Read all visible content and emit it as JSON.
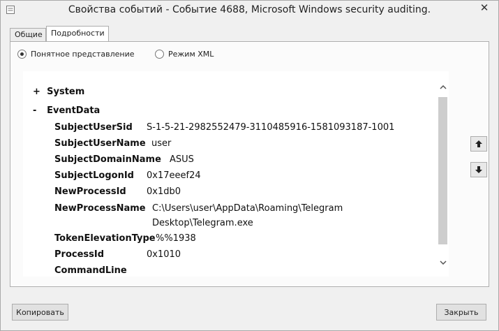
{
  "window": {
    "title": "Свойства событий - Событие 4688, Microsoft Windows security auditing.",
    "close_glyph": "✕"
  },
  "tabs": [
    {
      "label": "Общие"
    },
    {
      "label": "Подробности"
    }
  ],
  "view_mode": {
    "friendly": "Понятное представление",
    "xml": "Режим XML",
    "selected": "friendly"
  },
  "tree": {
    "system": {
      "sign": "+",
      "label": "System"
    },
    "eventdata": {
      "sign": "-",
      "label": "EventData"
    },
    "fields": [
      {
        "key": "SubjectUserSid",
        "value": "S-1-5-21-2982552479-3110485916-1581093187-1001"
      },
      {
        "key": "SubjectUserName",
        "value": "user"
      },
      {
        "key": "SubjectDomainName",
        "value": "ASUS"
      },
      {
        "key": "SubjectLogonId",
        "value": "0x17eeef24"
      },
      {
        "key": "NewProcessId",
        "value": "0x1db0"
      },
      {
        "key": "NewProcessName",
        "value": "C:\\Users\\user\\AppData\\Roaming\\Telegram",
        "value2": "Desktop\\Telegram.exe"
      },
      {
        "key": "TokenElevationType",
        "value": "%%1938"
      },
      {
        "key": "ProcessId",
        "value": "0x1010"
      },
      {
        "key": "CommandLine",
        "value": ""
      }
    ]
  },
  "buttons": {
    "copy": "Копировать",
    "close": "Закрыть"
  }
}
